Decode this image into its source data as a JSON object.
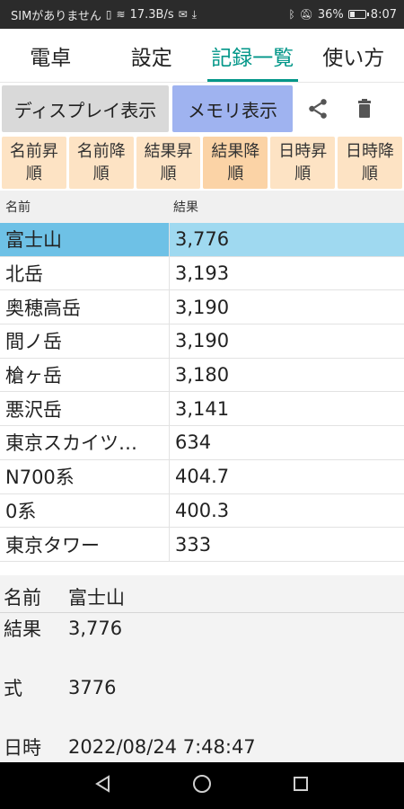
{
  "status": {
    "carrier": "SIMがありません",
    "speed": "17.3B/s",
    "battery": "36%",
    "battery_level": 0.36,
    "time": "8:07"
  },
  "tabs": [
    {
      "label": "電卓",
      "active": false
    },
    {
      "label": "設定",
      "active": false
    },
    {
      "label": "記録一覧",
      "active": true
    },
    {
      "label": "使い方",
      "active": false
    }
  ],
  "toolbar": {
    "display_label": "ディスプレイ表示",
    "memory_label": "メモリ表示",
    "share_icon": "share-icon",
    "delete_icon": "trash-icon"
  },
  "sort_buttons": [
    {
      "line1": "名前昇",
      "line2": "順"
    },
    {
      "line1": "名前降",
      "line2": "順"
    },
    {
      "line1": "結果昇",
      "line2": "順"
    },
    {
      "line1": "結果降",
      "line2": "順"
    },
    {
      "line1": "日時昇",
      "line2": "順"
    },
    {
      "line1": "日時降",
      "line2": "順"
    }
  ],
  "table": {
    "headers": [
      "名前",
      "結果"
    ],
    "rows": [
      {
        "name": "富士山",
        "result": "3,776"
      },
      {
        "name": "北岳",
        "result": "3,193"
      },
      {
        "name": "奥穂高岳",
        "result": "3,190"
      },
      {
        "name": "間ノ岳",
        "result": "3,190"
      },
      {
        "name": "槍ヶ岳",
        "result": "3,180"
      },
      {
        "name": "悪沢岳",
        "result": "3,141"
      },
      {
        "name": "東京スカイツ…",
        "result": "634"
      },
      {
        "name": "N700系",
        "result": "404.7"
      },
      {
        "name": "0系",
        "result": "400.3"
      },
      {
        "name": "東京タワー",
        "result": "333"
      }
    ]
  },
  "detail": {
    "name_label": "名前",
    "name_value": "富士山",
    "result_label": "結果",
    "result_value": "3,776",
    "formula_label": "式",
    "formula_value": "3776",
    "datetime_label": "日時",
    "datetime_value": "2022/08/24 7:48:47"
  },
  "colors": {
    "accent": "#009688",
    "memory_button": "#9fb3f0",
    "sort_button": "#fde3c4",
    "selected_row": "#9fd9f0"
  }
}
